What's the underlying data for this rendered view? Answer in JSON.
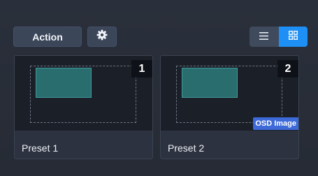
{
  "toolbar": {
    "action_label": "Action",
    "settings_icon": "gear-icon",
    "view_modes": [
      {
        "name": "list",
        "icon": "list-icon",
        "active": false
      },
      {
        "name": "grid",
        "icon": "grid-icon",
        "active": true
      }
    ]
  },
  "presets": [
    {
      "number": "1",
      "label": "Preset 1",
      "tag": ""
    },
    {
      "number": "2",
      "label": "Preset 2",
      "tag": "OSD Image"
    }
  ],
  "colors": {
    "accent": "#1e8ff5",
    "osd_tag": "#3d6ad8",
    "region_fill": "#2a6d6f"
  }
}
